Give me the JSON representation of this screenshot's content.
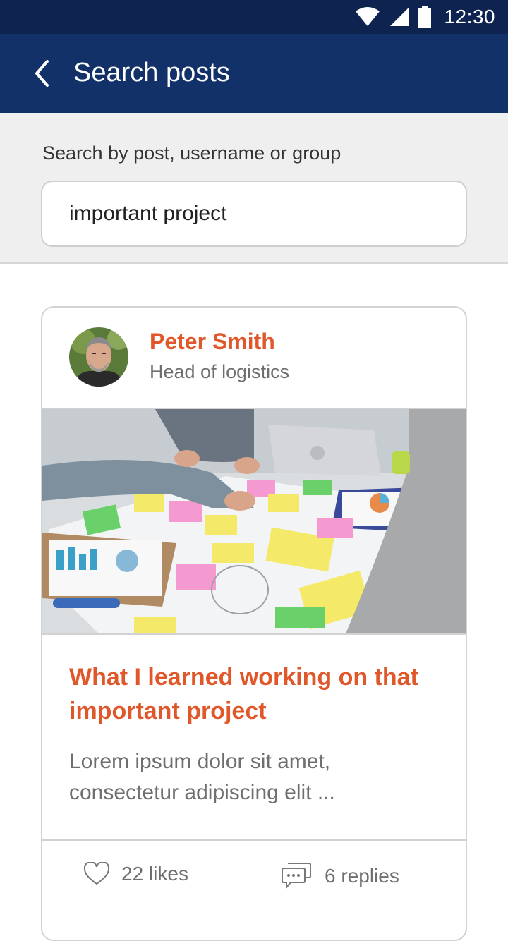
{
  "status_bar": {
    "time": "12:30",
    "icons": [
      "wifi-icon",
      "signal-icon",
      "battery-icon"
    ]
  },
  "header": {
    "title": "Search posts",
    "back_icon": "chevron-left-icon"
  },
  "search": {
    "label": "Search by post, username or group",
    "value": "important project"
  },
  "post": {
    "author": {
      "name": "Peter Smith",
      "role": "Head of logistics"
    },
    "title": "What I learned working on that important project",
    "excerpt": "Lorem ipsum dolor sit amet, consectetur adipiscing elit ...",
    "likes": "22 likes",
    "replies": "6 replies"
  },
  "colors": {
    "status_bar": "#0f2351",
    "app_bar": "#133169",
    "accent": "#e0572a",
    "muted_text": "#6f6f6f",
    "search_bg": "#efefef"
  }
}
